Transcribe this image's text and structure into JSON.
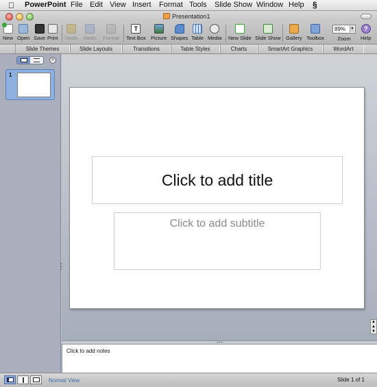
{
  "menubar": {
    "app_name": "PowerPoint",
    "items": [
      "File",
      "Edit",
      "View",
      "Insert",
      "Format",
      "Tools",
      "Slide Show",
      "Window",
      "Help"
    ]
  },
  "window": {
    "title": "Presentation1"
  },
  "toolbar": {
    "new": "New",
    "open": "Open",
    "save": "Save",
    "print": "Print",
    "undo": "Undo",
    "redo": "Redo",
    "format": "Format",
    "text_box": "Text Box",
    "picture": "Picture",
    "shapes": "Shapes",
    "table": "Table",
    "media": "Media",
    "new_slide": "New Slide",
    "slide_show": "Slide Show",
    "gallery": "Gallery",
    "toolbox": "Toolbox",
    "zoom_label": "Zoom",
    "zoom_value": "89%",
    "help": "Help"
  },
  "ribbon": {
    "tabs": [
      "Slide Themes",
      "Slide Layouts",
      "Transitions",
      "Table Styles",
      "Charts",
      "SmartArt Graphics",
      "WordArt"
    ]
  },
  "sidebar": {
    "slide_number": "1"
  },
  "slide": {
    "title_placeholder": "Click to add title",
    "subtitle_placeholder": "Click to add subtitle"
  },
  "notes": {
    "placeholder": "Click to add notes"
  },
  "status": {
    "view_name": "Normal View",
    "slide_count": "Slide 1 of 1"
  },
  "colors": {
    "accent": "#3a66b0",
    "selection": "#8db0e1"
  }
}
